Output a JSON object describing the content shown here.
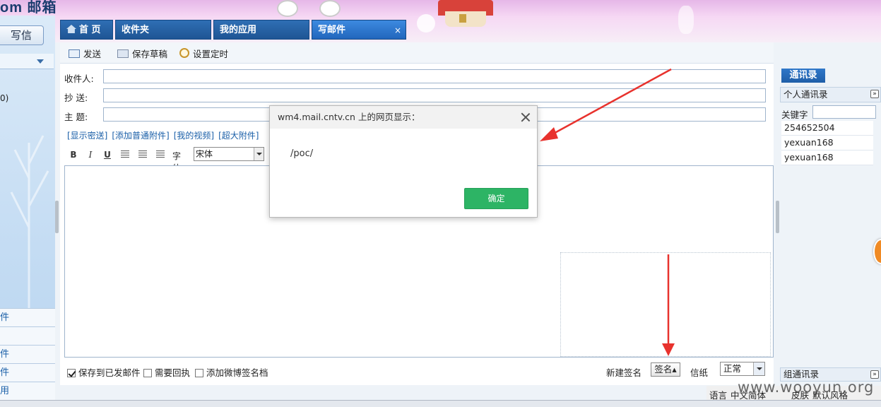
{
  "header": {
    "logo_text": "om 邮箱",
    "tabs": [
      {
        "label": "首 页",
        "icon": "home-icon"
      },
      {
        "label": "收件夹"
      },
      {
        "label": "我的应用"
      },
      {
        "label": "写邮件",
        "close": "×"
      }
    ]
  },
  "sidebar": {
    "write_label": "写信",
    "count_text": "0)",
    "links": [
      "件",
      "",
      "件",
      "件",
      "用"
    ]
  },
  "toolbar": {
    "send": "发送",
    "save_draft": "保存草稿",
    "schedule": "设置定时"
  },
  "compose": {
    "to_label": "收件人:",
    "cc_label": "抄  送:",
    "subject_label": "主  题:",
    "links": [
      "[显示密送]",
      "[添加普通附件]",
      "[我的视频]",
      "[超大附件]"
    ],
    "font_label": "字体",
    "font_value": "宋体",
    "format_buttons": [
      "B",
      "I",
      "U"
    ]
  },
  "bottom": {
    "save_sent": "保存到已发邮件",
    "receipt": "需要回执",
    "weibo_sig": "添加微博签名档",
    "new_sig": "新建签名",
    "sig_button": "签名▴",
    "paper_label": "信纸",
    "paper_value": "正常"
  },
  "contacts": {
    "tab": "通讯录",
    "personal": "个人通讯录",
    "keyword_label": "关键字",
    "items": [
      "254652504",
      "yexuan168",
      "yexuan168"
    ],
    "group": "组通讯录"
  },
  "lang_bar": {
    "lang_label": "语言",
    "lang_value": "中文简体",
    "skin_label": "皮肤",
    "skin_value": "默认风格"
  },
  "dialog": {
    "title": "wm4.mail.cntv.cn 上的网页显示：",
    "message": "/poc/",
    "ok": "确定"
  },
  "watermark": "www.wooyun.org",
  "colors": {
    "tab_blue": "#1e5594",
    "ok_green": "#2db465",
    "arrow_red": "#e8322d"
  }
}
